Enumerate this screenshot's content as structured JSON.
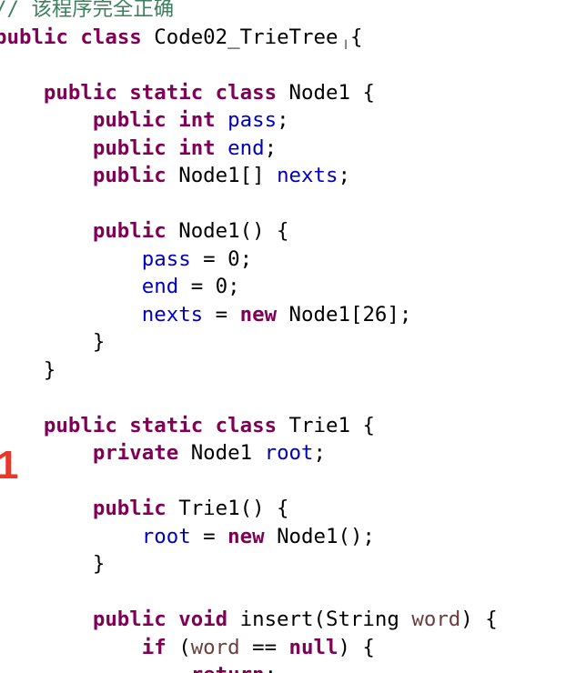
{
  "editor": {
    "lines": [
      [
        [
          "comment",
          "// 该程序完全正确"
        ]
      ],
      [
        [
          "kw",
          "public"
        ],
        [
          "plain",
          " "
        ],
        [
          "kw",
          "class"
        ],
        [
          "plain",
          " Code02_TrieTree {"
        ]
      ],
      [],
      [
        [
          "plain",
          "    "
        ],
        [
          "kw",
          "public"
        ],
        [
          "plain",
          " "
        ],
        [
          "kw",
          "static"
        ],
        [
          "plain",
          " "
        ],
        [
          "kw",
          "class"
        ],
        [
          "plain",
          " Node1 {"
        ]
      ],
      [
        [
          "plain",
          "        "
        ],
        [
          "kw",
          "public"
        ],
        [
          "plain",
          " "
        ],
        [
          "kw",
          "int"
        ],
        [
          "plain",
          " "
        ],
        [
          "field",
          "pass"
        ],
        [
          "plain",
          ";"
        ]
      ],
      [
        [
          "plain",
          "        "
        ],
        [
          "kw",
          "public"
        ],
        [
          "plain",
          " "
        ],
        [
          "kw",
          "int"
        ],
        [
          "plain",
          " "
        ],
        [
          "field",
          "end"
        ],
        [
          "plain",
          ";"
        ]
      ],
      [
        [
          "plain",
          "        "
        ],
        [
          "kw",
          "public"
        ],
        [
          "plain",
          " Node1[] "
        ],
        [
          "field",
          "nexts"
        ],
        [
          "plain",
          ";"
        ]
      ],
      [],
      [
        [
          "plain",
          "        "
        ],
        [
          "kw",
          "public"
        ],
        [
          "plain",
          " Node1() {"
        ]
      ],
      [
        [
          "plain",
          "            "
        ],
        [
          "field",
          "pass"
        ],
        [
          "plain",
          " = 0;"
        ]
      ],
      [
        [
          "plain",
          "            "
        ],
        [
          "field",
          "end"
        ],
        [
          "plain",
          " = 0;"
        ]
      ],
      [
        [
          "plain",
          "            "
        ],
        [
          "field",
          "nexts"
        ],
        [
          "plain",
          " = "
        ],
        [
          "kw",
          "new"
        ],
        [
          "plain",
          " Node1[26];"
        ]
      ],
      [
        [
          "plain",
          "        }"
        ]
      ],
      [
        [
          "plain",
          "    }"
        ]
      ],
      [],
      [
        [
          "plain",
          "    "
        ],
        [
          "kw",
          "public"
        ],
        [
          "plain",
          " "
        ],
        [
          "kw",
          "static"
        ],
        [
          "plain",
          " "
        ],
        [
          "kw",
          "class"
        ],
        [
          "plain",
          " Trie1 {"
        ]
      ],
      [
        [
          "plain",
          "        "
        ],
        [
          "kw",
          "private"
        ],
        [
          "plain",
          " Node1 "
        ],
        [
          "field",
          "root"
        ],
        [
          "plain",
          ";"
        ]
      ],
      [],
      [
        [
          "plain",
          "        "
        ],
        [
          "kw",
          "public"
        ],
        [
          "plain",
          " Trie1() {"
        ]
      ],
      [
        [
          "plain",
          "            "
        ],
        [
          "field",
          "root"
        ],
        [
          "plain",
          " = "
        ],
        [
          "kw",
          "new"
        ],
        [
          "plain",
          " Node1();"
        ]
      ],
      [
        [
          "plain",
          "        }"
        ]
      ],
      [],
      [
        [
          "plain",
          "        "
        ],
        [
          "kw",
          "public"
        ],
        [
          "plain",
          " "
        ],
        [
          "kw",
          "void"
        ],
        [
          "plain",
          " insert(String "
        ],
        [
          "param",
          "word"
        ],
        [
          "plain",
          ") {"
        ]
      ],
      [
        [
          "plain",
          "            "
        ],
        [
          "kw",
          "if"
        ],
        [
          "plain",
          " ("
        ],
        [
          "param",
          "word"
        ],
        [
          "plain",
          " == "
        ],
        [
          "kw",
          "null"
        ],
        [
          "plain",
          ") {"
        ]
      ],
      [
        [
          "plain",
          "                "
        ],
        [
          "kw",
          "return"
        ],
        [
          "plain",
          ";"
        ]
      ]
    ]
  },
  "gutter_marker": {
    "text": "1",
    "color": "#e8382c"
  },
  "cursor_glyph": "I",
  "colors": {
    "keyword": "#7f0055",
    "field": "#0000c0",
    "comment": "#3f7f5f",
    "parameter": "#6a3e3e",
    "text": "#000000",
    "background": "#ffffff"
  }
}
